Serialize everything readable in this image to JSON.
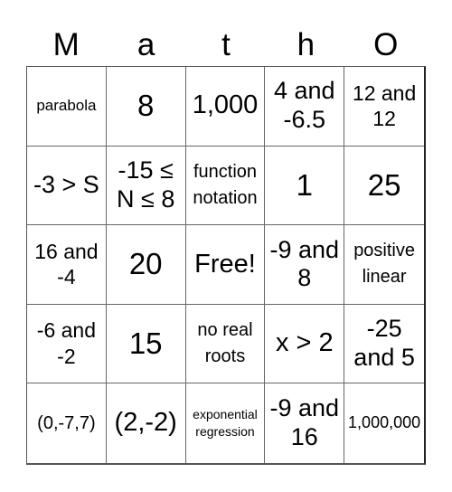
{
  "title_letters": [
    "M",
    "a",
    "t",
    "h",
    "O"
  ],
  "cells": [
    {
      "text": "parabola",
      "size": "s-tiny"
    },
    {
      "text": "8",
      "size": "s-xl"
    },
    {
      "text": "1,000",
      "size": "s-lg"
    },
    {
      "text": "4 and -6.5",
      "size": "s-md"
    },
    {
      "text": "12 and 12",
      "size": "s-sm"
    },
    {
      "text": "-3 > S",
      "size": "s-md"
    },
    {
      "text": "-15 ≤ N ≤ 8",
      "size": "s-md"
    },
    {
      "text": "function notation",
      "size": "s-xs"
    },
    {
      "text": "1",
      "size": "s-xl"
    },
    {
      "text": "25",
      "size": "s-xl"
    },
    {
      "text": "16 and -4",
      "size": "s-sm"
    },
    {
      "text": "20",
      "size": "s-xl"
    },
    {
      "text": "Free!",
      "size": "s-lg"
    },
    {
      "text": "-9 and 8",
      "size": "s-md"
    },
    {
      "text": "positive linear",
      "size": "s-xs"
    },
    {
      "text": "-6 and -2",
      "size": "s-sm"
    },
    {
      "text": "15",
      "size": "s-xl"
    },
    {
      "text": "no real roots",
      "size": "s-xs"
    },
    {
      "text": "x > 2",
      "size": "s-lg"
    },
    {
      "text": "-25 and 5",
      "size": "s-md"
    },
    {
      "text": "(0,-7,7)",
      "size": "s-xs"
    },
    {
      "text": "(2,-2)",
      "size": "s-lg"
    },
    {
      "text": "exponential regression",
      "size": "s-micro"
    },
    {
      "text": "-9 and 16",
      "size": "s-md"
    },
    {
      "text": "1,000,000",
      "size": "s-xxs"
    }
  ]
}
